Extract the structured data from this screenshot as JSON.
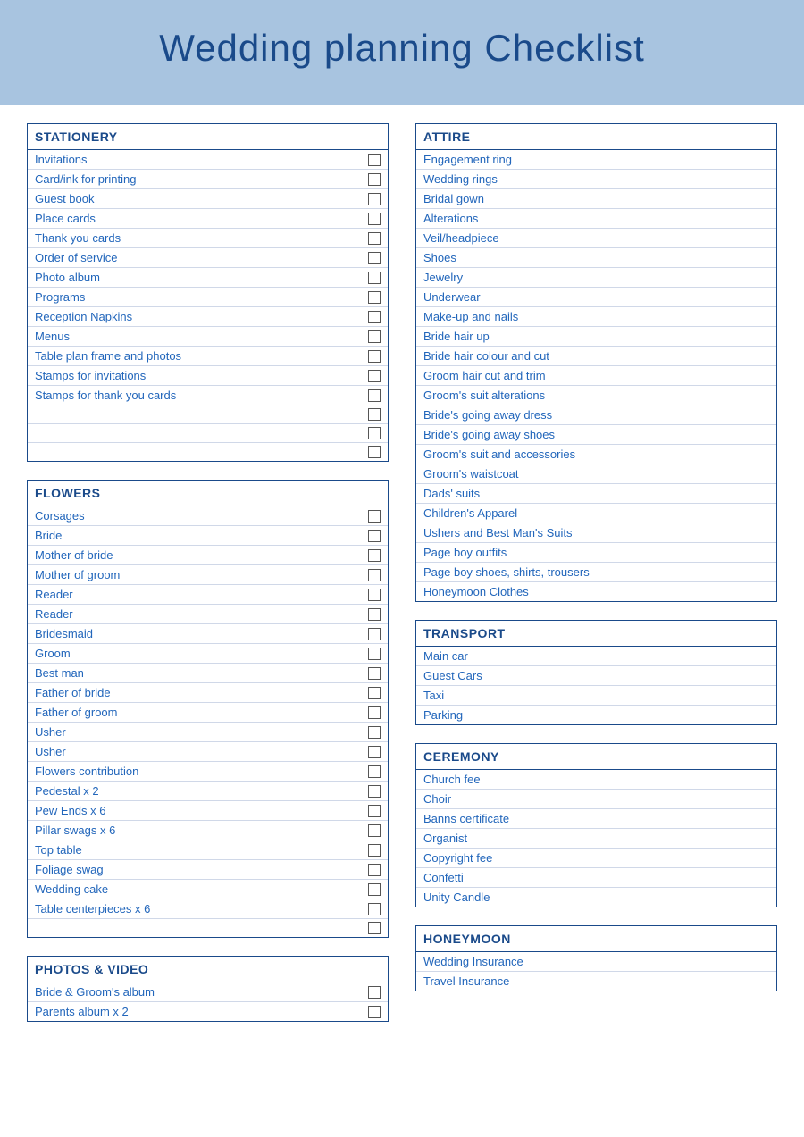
{
  "header": {
    "title": "Wedding planning Checklist"
  },
  "sections": [
    {
      "id": "stationery",
      "title": "STATIONERY",
      "has_checkboxes": true,
      "items": [
        "Invitations",
        "Card/ink for printing",
        "Guest book",
        "Place cards",
        "Thank you cards",
        "Order of service",
        "Photo album",
        "Programs",
        "Reception Napkins",
        "Menus",
        "Table plan frame and photos",
        "Stamps for invitations",
        "Stamps for thank you cards",
        "",
        "",
        ""
      ]
    },
    {
      "id": "attire",
      "title": "ATTIRE",
      "has_checkboxes": false,
      "items": [
        "Engagement ring",
        "Wedding rings",
        "Bridal gown",
        "Alterations",
        "Veil/headpiece",
        "Shoes",
        "Jewelry",
        "Underwear",
        "Make-up and nails",
        "Bride hair up",
        "Bride hair colour and cut",
        "Groom hair cut and trim",
        "Groom's suit alterations",
        "Bride's going away dress",
        "Bride's going away shoes",
        "Groom's suit and accessories",
        "Groom's waistcoat",
        "Dads' suits",
        "Children's Apparel",
        "Ushers and Best Man's Suits",
        "Page boy outfits",
        "Page boy shoes, shirts, trousers",
        "Honeymoon Clothes"
      ]
    },
    {
      "id": "flowers",
      "title": "FLOWERS",
      "has_checkboxes": true,
      "items": [
        "Corsages",
        "Bride",
        "Mother of bride",
        "Mother of groom",
        "Reader",
        "Reader",
        "Bridesmaid",
        "Groom",
        "Best man",
        "Father of bride",
        "Father of groom",
        "Usher",
        "Usher",
        "Flowers contribution",
        "Pedestal x 2",
        "Pew Ends x 6",
        "Pillar swags x 6",
        "Top table",
        "Foliage swag",
        "Wedding cake",
        "Table centerpieces x 6",
        ""
      ]
    },
    {
      "id": "transport",
      "title": "TRANSPORT",
      "has_checkboxes": false,
      "items": [
        "Main car",
        "Guest Cars",
        "Taxi",
        "Parking"
      ]
    },
    {
      "id": "photos-video",
      "title": "PHOTOS & VIDEO",
      "has_checkboxes": true,
      "items": [
        "Bride & Groom's album",
        "Parents album x 2"
      ]
    },
    {
      "id": "ceremony",
      "title": "CEREMONY",
      "has_checkboxes": false,
      "items": [
        "Church fee",
        "Choir",
        "Banns certificate",
        "Organist",
        "Copyright fee",
        "Confetti",
        "Unity Candle"
      ]
    },
    {
      "id": "honeymoon",
      "title": "HONEYMOON",
      "has_checkboxes": false,
      "items": [
        "Wedding Insurance",
        "Travel Insurance"
      ]
    }
  ]
}
